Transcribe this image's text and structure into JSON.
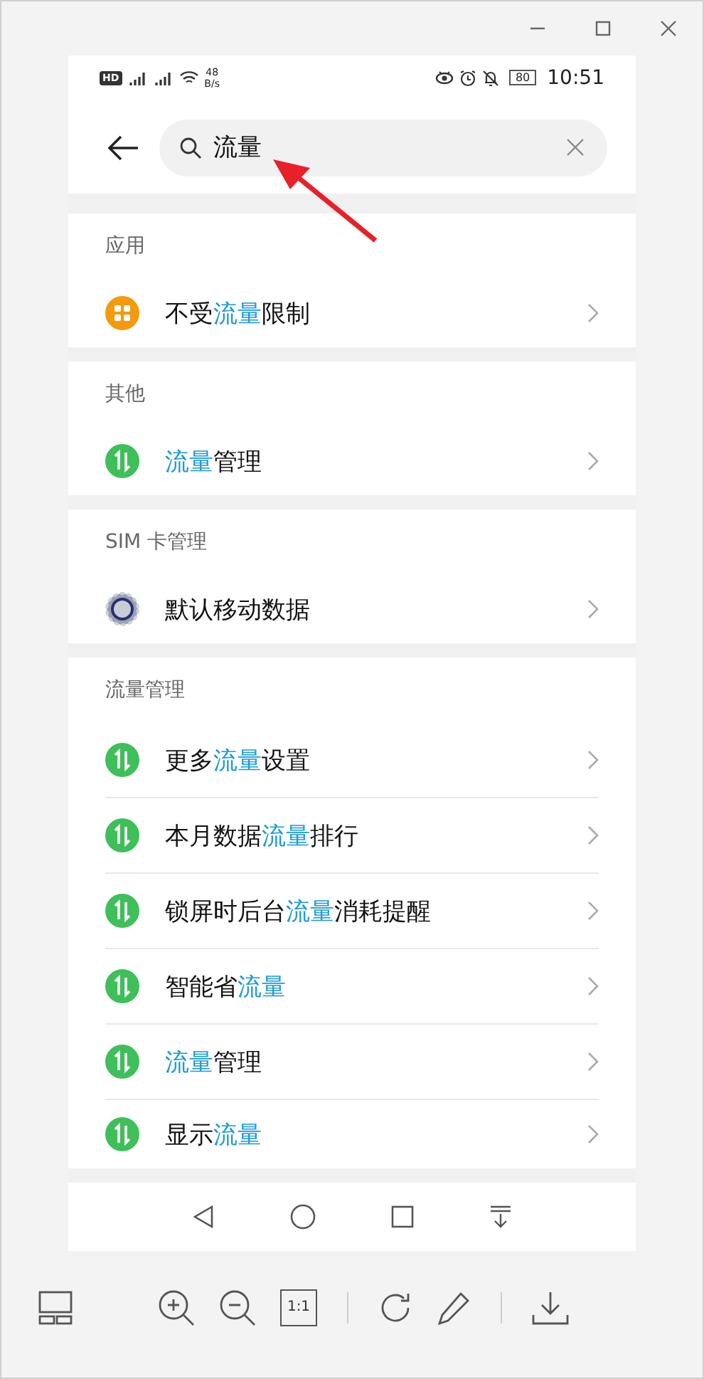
{
  "status_bar": {
    "hd": "HD",
    "speed_value": "48",
    "speed_unit": "B/s",
    "battery": "80",
    "time": "10:51"
  },
  "search": {
    "value": "流量"
  },
  "sections": [
    {
      "title": "应用",
      "items": [
        {
          "kind": "apps",
          "segments": [
            {
              "text": "不受",
              "highlight": false
            },
            {
              "text": "流量",
              "highlight": true
            },
            {
              "text": "限制",
              "highlight": false
            }
          ]
        }
      ]
    },
    {
      "title": "其他",
      "items": [
        {
          "kind": "traffic",
          "segments": [
            {
              "text": "流量",
              "highlight": true
            },
            {
              "text": "管理",
              "highlight": false
            }
          ]
        }
      ]
    },
    {
      "title": "SIM 卡管理",
      "items": [
        {
          "kind": "sim",
          "segments": [
            {
              "text": "默认移动数据",
              "highlight": false
            }
          ]
        }
      ]
    },
    {
      "title": "流量管理",
      "items": [
        {
          "kind": "traffic",
          "segments": [
            {
              "text": "更多",
              "highlight": false
            },
            {
              "text": "流量",
              "highlight": true
            },
            {
              "text": "设置",
              "highlight": false
            }
          ]
        },
        {
          "kind": "traffic",
          "segments": [
            {
              "text": "本月数据",
              "highlight": false
            },
            {
              "text": "流量",
              "highlight": true
            },
            {
              "text": "排行",
              "highlight": false
            }
          ]
        },
        {
          "kind": "traffic",
          "segments": [
            {
              "text": "锁屏时后台",
              "highlight": false
            },
            {
              "text": "流量",
              "highlight": true
            },
            {
              "text": "消耗提醒",
              "highlight": false
            }
          ]
        },
        {
          "kind": "traffic",
          "segments": [
            {
              "text": "智能省",
              "highlight": false
            },
            {
              "text": "流量",
              "highlight": true
            }
          ]
        },
        {
          "kind": "traffic",
          "segments": [
            {
              "text": "流量",
              "highlight": true
            },
            {
              "text": "管理",
              "highlight": false
            }
          ]
        },
        {
          "kind": "traffic",
          "segments": [
            {
              "text": "显示",
              "highlight": false
            },
            {
              "text": "流量",
              "highlight": true
            }
          ]
        }
      ]
    }
  ],
  "toolbar": {
    "actual_size": "1:1"
  }
}
